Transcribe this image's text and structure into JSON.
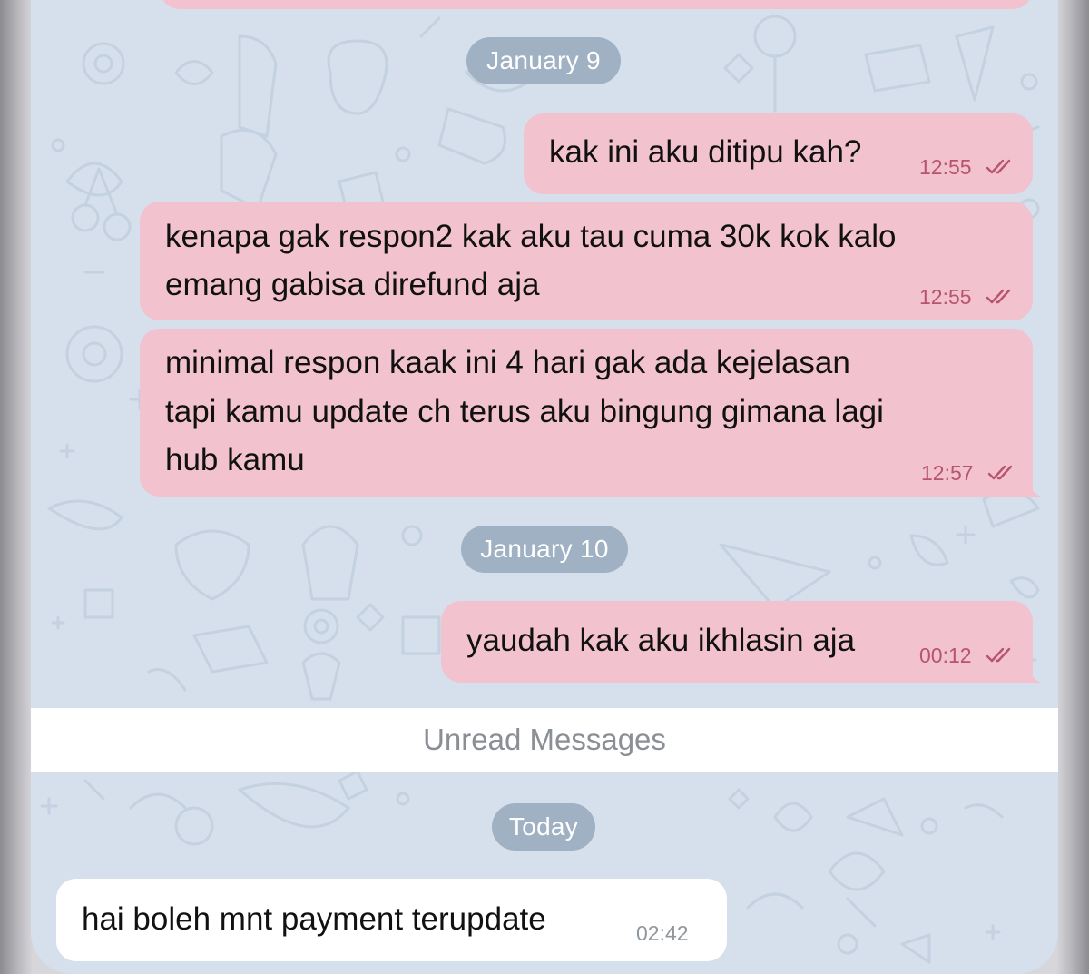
{
  "chat": {
    "date_separators": {
      "jan9": "January 9",
      "jan10": "January 10",
      "today": "Today"
    },
    "unread_label": "Unread Messages",
    "messages": [
      {
        "lines": [
          "kak ini aku ditipu kah?"
        ],
        "time": "12:55",
        "direction": "outgoing",
        "status": "read-double-check-icon"
      },
      {
        "lines": [
          "kenapa gak respon2 kak aku tau cuma 30k kok kalo",
          "emang gabisa direfund aja"
        ],
        "time": "12:55",
        "direction": "outgoing",
        "status": "read-double-check-icon"
      },
      {
        "lines": [
          "minimal respon kaak ini 4 hari gak ada kejelasan",
          "tapi kamu update ch terus aku bingung gimana lagi",
          "hub kamu"
        ],
        "time": "12:57",
        "direction": "outgoing",
        "status": "read-double-check-icon"
      },
      {
        "lines": [
          "yaudah kak aku ikhlasin aja"
        ],
        "time": "00:12",
        "direction": "outgoing",
        "status": "read-double-check-icon"
      },
      {
        "lines": [
          "hai boleh mnt payment terupdate"
        ],
        "time": "02:42",
        "direction": "incoming"
      }
    ]
  },
  "colors": {
    "wallpaper": "#d5e0ec",
    "outgoing_bubble": "#f2c2cf",
    "incoming_bubble": "#ffffff",
    "date_pill": "#9fb1c3",
    "outgoing_meta": "#b8546f"
  }
}
